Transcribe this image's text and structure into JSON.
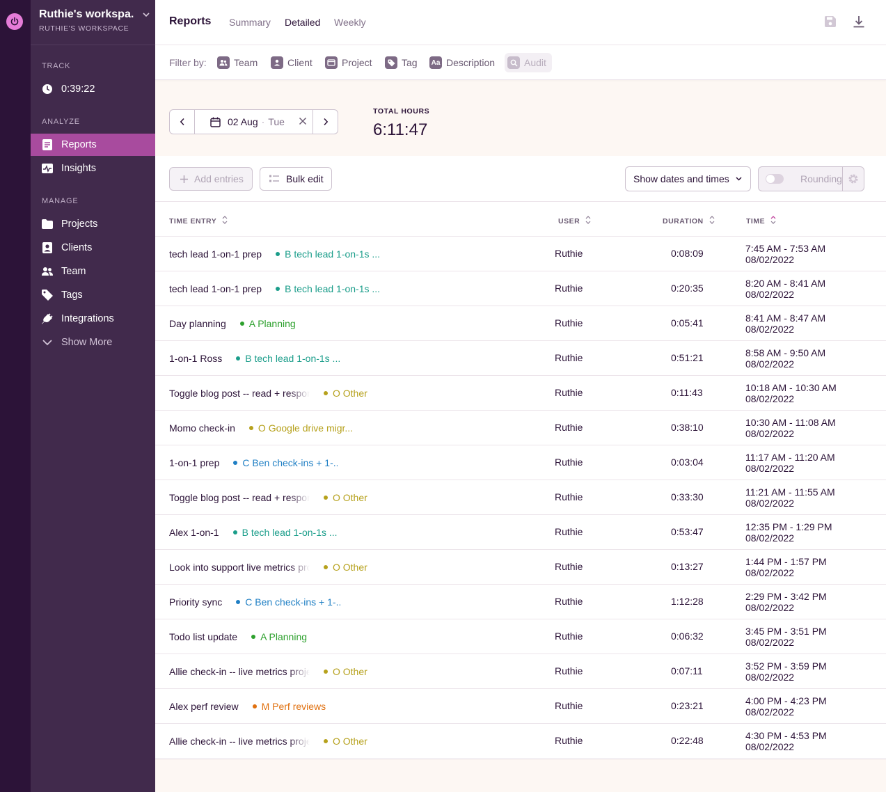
{
  "workspace": {
    "name": "Ruthie's workspa...",
    "subtitle": "RUTHIE'S WORKSPACE"
  },
  "sidebar": {
    "track_label": "TRACK",
    "timer": "0:39:22",
    "analyze_label": "ANALYZE",
    "analyze_items": [
      {
        "label": "Reports",
        "icon": "reports-icon",
        "active": true
      },
      {
        "label": "Insights",
        "icon": "insights-icon"
      }
    ],
    "manage_label": "MANAGE",
    "manage_items": [
      {
        "label": "Projects",
        "icon": "folder-icon"
      },
      {
        "label": "Clients",
        "icon": "client-icon"
      },
      {
        "label": "Team",
        "icon": "team-icon"
      },
      {
        "label": "Tags",
        "icon": "tag-icon"
      },
      {
        "label": "Integrations",
        "icon": "plug-icon"
      },
      {
        "label": "Show More",
        "icon": "chevron-down-icon"
      }
    ]
  },
  "header": {
    "title": "Reports",
    "tabs": [
      {
        "label": "Summary"
      },
      {
        "label": "Detailed",
        "selected": true
      },
      {
        "label": "Weekly"
      }
    ]
  },
  "filters": {
    "label": "Filter by:",
    "items": [
      {
        "label": "Team",
        "icon": "team-icon"
      },
      {
        "label": "Client",
        "icon": "client-icon"
      },
      {
        "label": "Project",
        "icon": "folder-icon"
      },
      {
        "label": "Tag",
        "icon": "tag-icon"
      },
      {
        "label": "Description",
        "icon": "text-icon",
        "glyph": "Aa"
      },
      {
        "label": "Audit",
        "icon": "audit-search-icon",
        "disabled": true
      }
    ]
  },
  "date": {
    "value": "02 Aug",
    "sep": "·",
    "weekday": "Tue"
  },
  "totals": {
    "label": "TOTAL HOURS",
    "value": "6:11:47"
  },
  "toolbar": {
    "add_entries": "Add entries",
    "bulk_edit": "Bulk edit",
    "show_dates": "Show dates and times",
    "rounding": "Rounding"
  },
  "table": {
    "headers": {
      "entry": "TIME ENTRY",
      "user": "USER",
      "duration": "DURATION",
      "time": "TIME"
    },
    "rows": [
      {
        "desc": "tech lead 1-on-1 prep",
        "project": "B tech lead 1-on-1s ...",
        "color": "#1a9d8a",
        "user": "Ruthie",
        "duration": "0:08:09",
        "range": "7:45 AM - 7:53 AM",
        "date": "08/02/2022"
      },
      {
        "desc": "tech lead 1-on-1 prep",
        "project": "B tech lead 1-on-1s ...",
        "color": "#1a9d8a",
        "user": "Ruthie",
        "duration": "0:20:35",
        "range": "8:20 AM - 8:41 AM",
        "date": "08/02/2022"
      },
      {
        "desc": "Day planning",
        "project": "A Planning",
        "color": "#2da02d",
        "user": "Ruthie",
        "duration": "0:05:41",
        "range": "8:41 AM - 8:47 AM",
        "date": "08/02/2022"
      },
      {
        "desc": "1-on-1 Ross",
        "project": "B tech lead 1-on-1s ...",
        "color": "#1a9d8a",
        "user": "Ruthie",
        "duration": "0:51:21",
        "range": "8:58 AM - 9:50 AM",
        "date": "08/02/2022"
      },
      {
        "desc": "Toggle blog post -- read + respond",
        "trunc": true,
        "project": "O Other",
        "color": "#b6a11c",
        "user": "Ruthie",
        "duration": "0:11:43",
        "range": "10:18 AM - 10:30 AM",
        "date": "08/02/2022"
      },
      {
        "desc": "Momo check-in",
        "project": "O Google drive migr...",
        "color": "#b6a11c",
        "user": "Ruthie",
        "duration": "0:38:10",
        "range": "10:30 AM - 11:08 AM",
        "date": "08/02/2022"
      },
      {
        "desc": "1-on-1 prep",
        "project": "C Ben check-ins + 1-...",
        "color": "#1f7fc4",
        "user": "Ruthie",
        "duration": "0:03:04",
        "range": "11:17 AM - 11:20 AM",
        "date": "08/02/2022"
      },
      {
        "desc": "Toggle blog post -- read + respond",
        "trunc": true,
        "project": "O Other",
        "color": "#b6a11c",
        "user": "Ruthie",
        "duration": "0:33:30",
        "range": "11:21 AM - 11:55 AM",
        "date": "08/02/2022"
      },
      {
        "desc": "Alex 1-on-1",
        "project": "B tech lead 1-on-1s ...",
        "color": "#1a9d8a",
        "user": "Ruthie",
        "duration": "0:53:47",
        "range": "12:35 PM - 1:29 PM",
        "date": "08/02/2022"
      },
      {
        "desc": "Look into support live metrics project",
        "trunc": true,
        "project": "O Other",
        "color": "#b6a11c",
        "user": "Ruthie",
        "duration": "0:13:27",
        "range": "1:44 PM - 1:57 PM",
        "date": "08/02/2022"
      },
      {
        "desc": "Priority sync",
        "project": "C Ben check-ins + 1-...",
        "color": "#1f7fc4",
        "user": "Ruthie",
        "duration": "1:12:28",
        "range": "2:29 PM - 3:42 PM",
        "date": "08/02/2022"
      },
      {
        "desc": "Todo list update",
        "project": "A Planning",
        "color": "#2da02d",
        "user": "Ruthie",
        "duration": "0:06:32",
        "range": "3:45 PM - 3:51 PM",
        "date": "08/02/2022"
      },
      {
        "desc": "Allie check-in -- live metrics project",
        "trunc": true,
        "project": "O Other",
        "color": "#b6a11c",
        "user": "Ruthie",
        "duration": "0:07:11",
        "range": "3:52 PM - 3:59 PM",
        "date": "08/02/2022"
      },
      {
        "desc": "Alex perf review",
        "project": "M Perf reviews",
        "color": "#e0700f",
        "user": "Ruthie",
        "duration": "0:23:21",
        "range": "4:00 PM - 4:23 PM",
        "date": "08/02/2022"
      },
      {
        "desc": "Allie check-in -- live metrics project",
        "trunc": true,
        "project": "O Other",
        "color": "#b6a11c",
        "user": "Ruthie",
        "duration": "0:22:48",
        "range": "4:30 PM - 4:53 PM",
        "date": "08/02/2022"
      }
    ]
  },
  "colors": {
    "sidebar": "#412a4c",
    "rail": "#2c1338",
    "accent": "#a84b9e",
    "power": "#e57cd8"
  }
}
